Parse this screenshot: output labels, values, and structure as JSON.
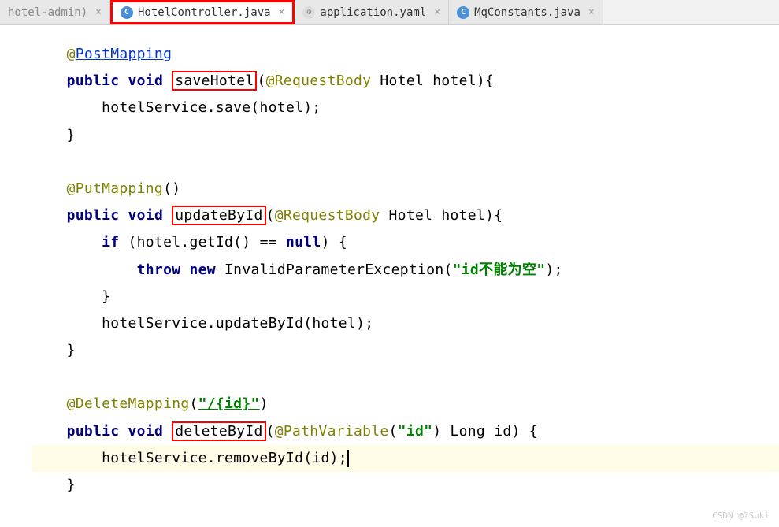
{
  "tabs": [
    {
      "label": "hotel-admin)",
      "icon": "none",
      "active": false
    },
    {
      "label": "HotelController.java",
      "icon": "java",
      "active": true
    },
    {
      "label": "application.yaml",
      "icon": "yaml",
      "active": false
    },
    {
      "label": "MqConstants.java",
      "icon": "java",
      "active": false
    }
  ],
  "code": {
    "l1_at": "@",
    "l1_anno": "PostMapping",
    "l2_pub": "public",
    "l2_void": "void",
    "l2_method": "saveHotel",
    "l2_rest": "(@RequestBody Hotel hotel){",
    "l2_anno": "@RequestBody",
    "l3": "        hotelService.save(hotel);",
    "l4": "    }",
    "l6": "    @PutMapping()",
    "l7_method": "updateById",
    "l7_rest": "(@RequestBody Hotel hotel){",
    "l8_if": "if",
    "l8_cond": " (hotel.getId() == ",
    "l8_null": "null",
    "l8_end": ") {",
    "l9_throw": "throw",
    "l9_new": "new",
    "l9_ex": " InvalidParameterException(",
    "l9_str": "\"id不能为空\"",
    "l9_end": ");",
    "l10": "        }",
    "l11": "        hotelService.updateById(hotel);",
    "l12": "    }",
    "l14_anno": "    @DeleteMapping(",
    "l14_str": "\"/{id}\"",
    "l14_end": ")",
    "l15_method": "deleteById",
    "l15_open": "(",
    "l15_pv": "@PathVariable",
    "l15_pvopen": "(",
    "l15_pvstr": "\"id\"",
    "l15_pvend": ")",
    "l15_rest": " Long id) {",
    "l16": "        hotelService.removeById(id);",
    "l17": "    }"
  },
  "watermark": "CSDN @?Suki"
}
